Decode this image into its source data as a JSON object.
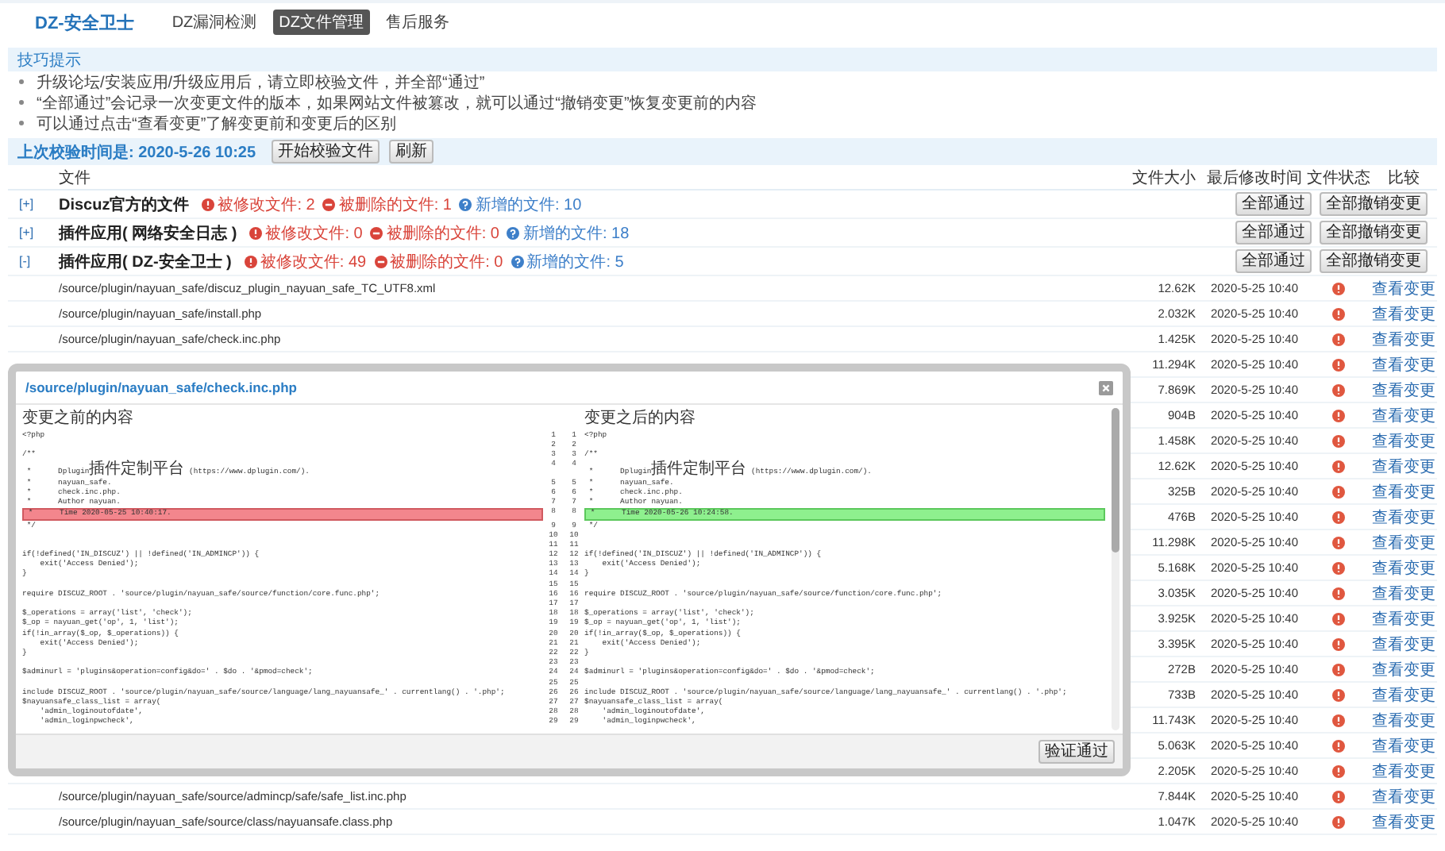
{
  "app": {
    "title": "DZ-安全卫士",
    "tabs": [
      {
        "label": "DZ漏洞检测",
        "selected": false
      },
      {
        "label": "DZ文件管理",
        "selected": true
      },
      {
        "label": "售后服务",
        "selected": false
      }
    ]
  },
  "tips": {
    "title": "技巧提示",
    "items": [
      "升级论坛/安装应用/升级应用后，请立即校验文件，并全部“通过”",
      "“全部通过”会记录一次变更文件的版本，如果网站文件被篡改，就可以通过“撤销变更”恢复变更前的内容",
      "可以通过点击“查看变更”了解变更前和变更后的区别"
    ]
  },
  "check_bar": {
    "label": "上次校验时间是: 2020-5-26 10:25",
    "buttons": [
      "开始校验文件",
      "刷新"
    ]
  },
  "table": {
    "columns": [
      "文件",
      "文件大小",
      "最后修改时间",
      "文件状态",
      "比较"
    ],
    "groups": [
      {
        "toggle": "[+]",
        "name": "Discuz官方的文件",
        "counts": [
          {
            "kind": "modified",
            "text": "被修改文件: 2"
          },
          {
            "kind": "deleted",
            "text": "被删除的文件: 1"
          },
          {
            "kind": "added",
            "text": "新增的文件: 10"
          }
        ],
        "buttons": [
          "全部通过",
          "全部撤销变更"
        ]
      },
      {
        "toggle": "[+]",
        "name": "插件应用( 网络安全日志 )",
        "counts": [
          {
            "kind": "modified",
            "text": "被修改文件: 0"
          },
          {
            "kind": "deleted",
            "text": "被删除的文件: 0"
          },
          {
            "kind": "added",
            "text": "新增的文件: 18"
          }
        ],
        "buttons": [
          "全部通过",
          "全部撤销变更"
        ]
      },
      {
        "toggle": "[-]",
        "name": "插件应用( DZ-安全卫士 )",
        "counts": [
          {
            "kind": "modified",
            "text": "被修改文件: 49"
          },
          {
            "kind": "deleted",
            "text": "被删除的文件: 0"
          },
          {
            "kind": "added",
            "text": "新增的文件: 5"
          }
        ],
        "buttons": [
          "全部通过",
          "全部撤销变更"
        ]
      }
    ],
    "rows": [
      {
        "path": "/source/plugin/nayuan_safe/discuz_plugin_nayuan_safe_TC_UTF8.xml",
        "size": "12.62K",
        "modified": "2020-5-25 10:40",
        "action": "查看变更"
      },
      {
        "path": "/source/plugin/nayuan_safe/install.php",
        "size": "2.032K",
        "modified": "2020-5-25 10:40",
        "action": "查看变更"
      },
      {
        "path": "/source/plugin/nayuan_safe/check.inc.php",
        "size": "1.425K",
        "modified": "2020-5-25 10:40",
        "action": "查看变更"
      },
      {
        "size": "11.294K",
        "modified": "2020-5-25 10:40",
        "action": "查看变更"
      },
      {
        "size": "7.869K",
        "modified": "2020-5-25 10:40",
        "action": "查看变更"
      },
      {
        "size": "904B",
        "modified": "2020-5-25 10:40",
        "action": "查看变更"
      },
      {
        "size": "1.458K",
        "modified": "2020-5-25 10:40",
        "action": "查看变更"
      },
      {
        "size": "12.62K",
        "modified": "2020-5-25 10:40",
        "action": "查看变更"
      },
      {
        "size": "325B",
        "modified": "2020-5-25 10:40",
        "action": "查看变更"
      },
      {
        "size": "476B",
        "modified": "2020-5-25 10:40",
        "action": "查看变更"
      },
      {
        "size": "11.298K",
        "modified": "2020-5-25 10:40",
        "action": "查看变更"
      },
      {
        "size": "5.168K",
        "modified": "2020-5-25 10:40",
        "action": "查看变更"
      },
      {
        "size": "3.035K",
        "modified": "2020-5-25 10:40",
        "action": "查看变更"
      },
      {
        "size": "3.925K",
        "modified": "2020-5-25 10:40",
        "action": "查看变更"
      },
      {
        "size": "3.395K",
        "modified": "2020-5-25 10:40",
        "action": "查看变更"
      },
      {
        "size": "272B",
        "modified": "2020-5-25 10:40",
        "action": "查看变更"
      },
      {
        "size": "733B",
        "modified": "2020-5-25 10:40",
        "action": "查看变更"
      },
      {
        "size": "11.743K",
        "modified": "2020-5-25 10:40",
        "action": "查看变更"
      },
      {
        "size": "5.063K",
        "modified": "2020-5-25 10:40",
        "action": "查看变更"
      },
      {
        "size": "2.205K",
        "modified": "2020-5-25 10:40",
        "action": "查看变更"
      },
      {
        "path": "/source/plugin/nayuan_safe/source/admincp/safe/safe_list.inc.php",
        "size": "7.844K",
        "modified": "2020-5-25 10:40",
        "action": "查看变更"
      },
      {
        "path": "/source/plugin/nayuan_safe/source/class/nayuansafe.class.php",
        "size": "1.047K",
        "modified": "2020-5-25 10:40",
        "action": "查看变更"
      }
    ]
  },
  "dialog": {
    "title": "/source/plugin/nayuan_safe/check.inc.php",
    "before_label": "变更之前的内容",
    "after_label": "变更之后的内容",
    "button": "验证通过",
    "lines": [
      {
        "old_no": "1",
        "new_no": "1",
        "old": "<?php",
        "new": "<?php",
        "changed": false
      },
      {
        "old_no": "2",
        "new_no": "2",
        "changed": false
      },
      {
        "old_no": "3",
        "new_no": "3",
        "old": "/**",
        "new": "/**",
        "changed": false
      },
      {
        "old_no": "4",
        "new_no": "4",
        "old": " *      Dplugin插件定制平台 (https://www.dplugin.com/).",
        "new": " *      Dplugin插件定制平台 (https://www.dplugin.com/).",
        "changed": false
      },
      {
        "old_no": "5",
        "new_no": "5",
        "old": " *      nayuan_safe.",
        "new": " *      nayuan_safe.",
        "changed": false
      },
      {
        "old_no": "6",
        "new_no": "6",
        "old": " *      check.inc.php.",
        "new": " *      check.inc.php.",
        "changed": false
      },
      {
        "old_no": "7",
        "new_no": "7",
        "old": " *      Author nayuan.",
        "new": " *      Author nayuan.",
        "changed": false
      },
      {
        "old_no": "8",
        "new_no": "8",
        "old": " *      Time 2020-05-25 10:40:17.",
        "new": " *      Time 2020-05-26 10:24:58.",
        "changed": true
      },
      {
        "old_no": "9",
        "new_no": "9",
        "old": " */",
        "new": " */",
        "changed": false
      },
      {
        "old_no": "10",
        "new_no": "10",
        "changed": false
      },
      {
        "old_no": "11",
        "new_no": "11",
        "changed": false
      },
      {
        "old_no": "12",
        "new_no": "12",
        "old": "if(!defined('IN_DISCUZ') || !defined('IN_ADMINCP')) {",
        "new": "if(!defined('IN_DISCUZ') || !defined('IN_ADMINCP')) {",
        "changed": false
      },
      {
        "old_no": "13",
        "new_no": "13",
        "old": "    exit('Access Denied');",
        "new": "    exit('Access Denied');",
        "changed": false
      },
      {
        "old_no": "14",
        "new_no": "14",
        "old": "}",
        "new": "}",
        "changed": false
      },
      {
        "old_no": "15",
        "new_no": "15",
        "changed": false
      },
      {
        "old_no": "16",
        "new_no": "16",
        "old": "require DISCUZ_ROOT . 'source/plugin/nayuan_safe/source/function/core.func.php';",
        "new": "require DISCUZ_ROOT . 'source/plugin/nayuan_safe/source/function/core.func.php';",
        "changed": false
      },
      {
        "old_no": "17",
        "new_no": "17",
        "changed": false
      },
      {
        "old_no": "18",
        "new_no": "18",
        "old": "$_operations = array('list', 'check');",
        "new": "$_operations = array('list', 'check');",
        "changed": false
      },
      {
        "old_no": "19",
        "new_no": "19",
        "old": "$_op = nayuan_get('op', 1, 'list');",
        "new": "$_op = nayuan_get('op', 1, 'list');",
        "changed": false
      },
      {
        "old_no": "20",
        "new_no": "20",
        "old": "if(!in_array($_op, $_operations)) {",
        "new": "if(!in_array($_op, $_operations)) {",
        "changed": false
      },
      {
        "old_no": "21",
        "new_no": "21",
        "old": "    exit('Access Denied');",
        "new": "    exit('Access Denied');",
        "changed": false
      },
      {
        "old_no": "22",
        "new_no": "22",
        "old": "}",
        "new": "}",
        "changed": false
      },
      {
        "old_no": "23",
        "new_no": "23",
        "changed": false
      },
      {
        "old_no": "24",
        "new_no": "24",
        "old": "$adminurl = 'plugins&operation=config&do=' . $do . '&pmod=check';",
        "new": "$adminurl = 'plugins&operation=config&do=' . $do . '&pmod=check';",
        "changed": false
      },
      {
        "old_no": "25",
        "new_no": "25",
        "changed": false
      },
      {
        "old_no": "26",
        "new_no": "26",
        "old": "include DISCUZ_ROOT . 'source/plugin/nayuan_safe/source/language/lang_nayuansafe_' . currentlang() . '.php';",
        "new": "include DISCUZ_ROOT . 'source/plugin/nayuan_safe/source/language/lang_nayuansafe_' . currentlang() . '.php';",
        "changed": false
      },
      {
        "old_no": "27",
        "new_no": "27",
        "old": "$nayuansafe_class_list = array(",
        "new": "$nayuansafe_class_list = array(",
        "changed": false
      },
      {
        "old_no": "28",
        "new_no": "28",
        "old": "    'admin_loginoutofdate',",
        "new": "    'admin_loginoutofdate',",
        "changed": false
      },
      {
        "old_no": "29",
        "new_no": "29",
        "old": "    'admin_loginpwcheck',",
        "new": "    'admin_loginpwcheck',",
        "changed": false
      }
    ]
  }
}
